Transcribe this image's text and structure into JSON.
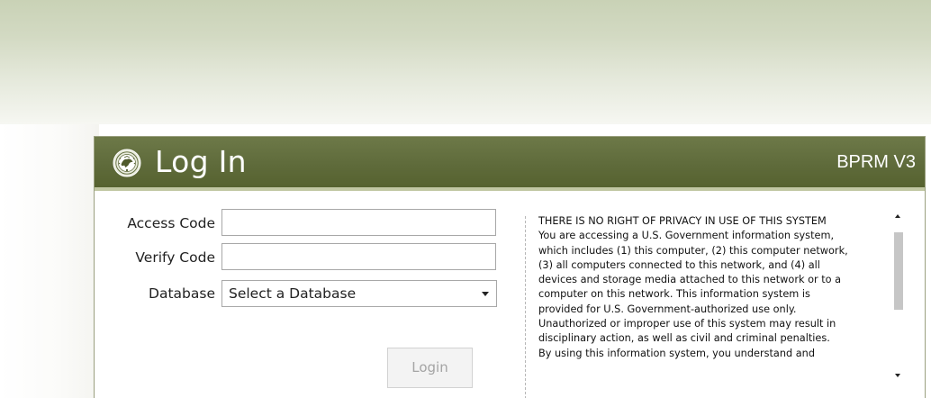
{
  "header": {
    "title": "Log In",
    "version": "BPRM V3",
    "seal_icon": "department-seal-icon",
    "background_color": "#5f6b3b",
    "text_color": "#ffffff"
  },
  "form": {
    "access_code": {
      "label": "Access Code",
      "value": "",
      "placeholder": ""
    },
    "verify_code": {
      "label": "Verify Code",
      "value": "",
      "placeholder": ""
    },
    "database": {
      "label": "Database",
      "selected": "Select a Database"
    },
    "login_button": {
      "label": "Login",
      "state": "disabled"
    }
  },
  "notice": {
    "lines": [
      "THERE IS NO RIGHT OF PRIVACY IN USE OF THIS SYSTEM",
      "You are accessing a U.S. Government information system,",
      "which includes (1) this computer, (2) this computer network,",
      "(3) all computers connected to this network, and (4) all",
      "devices and storage media attached to this network or to a",
      "computer on this network. This information system is",
      "provided for U.S. Government-authorized use only.",
      "Unauthorized or improper use of this system may result in",
      "disciplinary action, as well as civil and criminal penalties.",
      "By using this information system, you understand and"
    ],
    "scroll_up_icon": "scroll-up-arrow-icon",
    "scroll_down_icon": "scroll-down-arrow-icon"
  }
}
